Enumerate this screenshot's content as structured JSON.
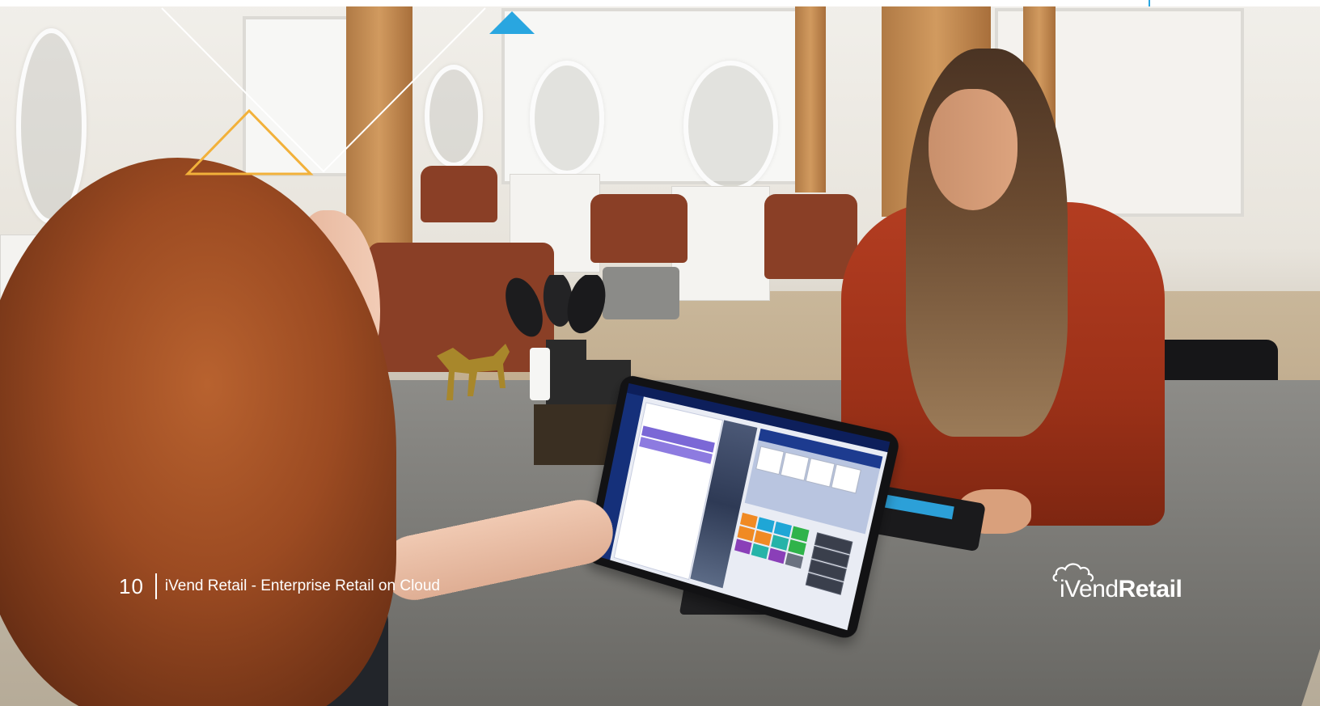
{
  "footer": {
    "page_number": "10",
    "title": "iVend Retail - Enterprise Retail on Cloud"
  },
  "brand": {
    "logo_prefix": "iVend",
    "logo_suffix": "Retail"
  },
  "colors": {
    "accent_blue": "#29a6e0",
    "accent_orange": "#f2b13a",
    "footer_text": "#ffffff"
  },
  "icons": [
    "cloud-logo-icon",
    "triangle-decoration-icon"
  ]
}
